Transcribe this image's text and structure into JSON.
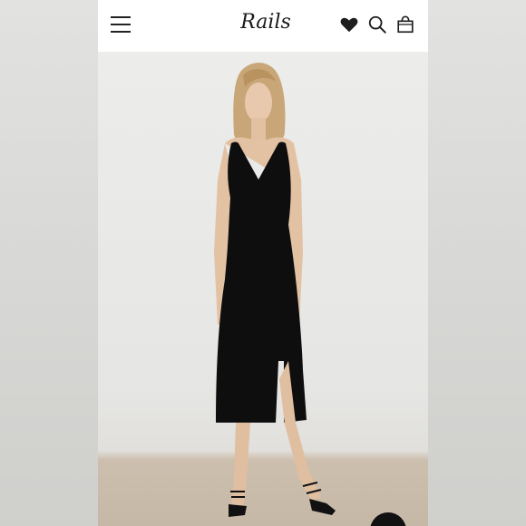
{
  "header": {
    "logo_text": "Rails",
    "icons": [
      "menu-icon",
      "heart-icon",
      "search-icon",
      "bag-icon"
    ]
  },
  "product_image": {
    "subject": "model-in-black-sleeveless-midi-dress",
    "dress_color": "#0e0e0e",
    "background_color": "#e8e8e6",
    "floor_color": "#c8baa8"
  },
  "colors": {
    "header_background": "#ffffff",
    "icon_color": "#222222",
    "outer_background": "#d8d8d6"
  }
}
